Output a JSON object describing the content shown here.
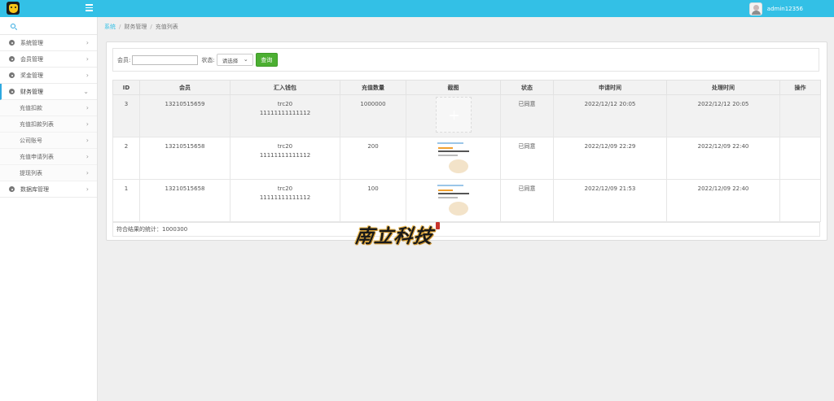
{
  "header": {
    "user_name": "admin12356",
    "logo_icon": "smiley-logo-icon",
    "menu_icon": "hamburger-menu-icon",
    "brand_color": "#33c0e6"
  },
  "sidebar": {
    "search_icon": "search-icon",
    "items": [
      {
        "label": "系统管理"
      },
      {
        "label": "会员管理"
      },
      {
        "label": "奖金管理"
      },
      {
        "label": "财务管理"
      },
      {
        "label": "数据库管理"
      }
    ],
    "finance_sub": [
      {
        "label": "充值扣款"
      },
      {
        "label": "充值扣款列表"
      },
      {
        "label": "公司账号"
      },
      {
        "label": "充值申请列表"
      },
      {
        "label": "提现列表"
      }
    ]
  },
  "breadcrumb": {
    "home": "系统",
    "section": "财务管理",
    "current": "充值列表"
  },
  "filter": {
    "member_label": "会员:",
    "member_value": "",
    "status_label": "状态:",
    "status_value": "请选择",
    "search_button": "查询"
  },
  "table": {
    "headers": [
      "ID",
      "会员",
      "汇入钱包",
      "充值数量",
      "截图",
      "状态",
      "申请时间",
      "处理时间",
      "操作"
    ],
    "rows": [
      {
        "id": "3",
        "member": "13210515659",
        "wallet_type": "trc20",
        "wallet_addr": "11111111111112",
        "amount": "1000000",
        "screenshot": "placeholder",
        "status": "已同意",
        "apply_time": "2022/12/12 20:05",
        "process_time": "2022/12/12 20:05",
        "action": ""
      },
      {
        "id": "2",
        "member": "13210515658",
        "wallet_type": "trc20",
        "wallet_addr": "11111111111112",
        "amount": "200",
        "screenshot": "receipt",
        "status": "已同意",
        "apply_time": "2022/12/09 22:29",
        "process_time": "2022/12/09 22:40",
        "action": ""
      },
      {
        "id": "1",
        "member": "13210515658",
        "wallet_type": "trc20",
        "wallet_addr": "11111111111112",
        "amount": "100",
        "screenshot": "receipt",
        "status": "已同意",
        "apply_time": "2022/12/09 21:53",
        "process_time": "2022/12/09 22:40",
        "action": ""
      }
    ],
    "summary": "符合结果的统计：1000300"
  },
  "watermark": {
    "text": "南立科技"
  }
}
